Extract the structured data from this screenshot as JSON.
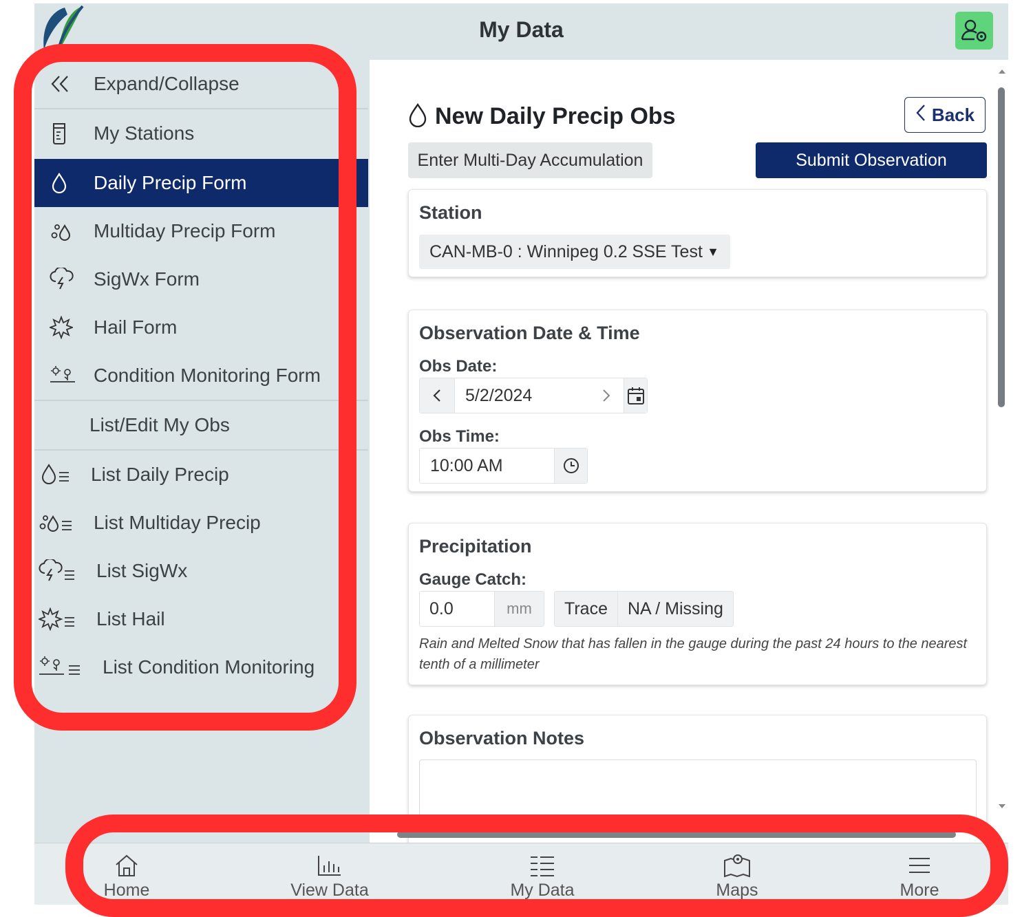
{
  "header": {
    "title": "My Data"
  },
  "sidebar": {
    "items": [
      {
        "label": "Expand/Collapse"
      },
      {
        "label": "My Stations"
      },
      {
        "label": "Daily Precip Form"
      },
      {
        "label": "Multiday Precip Form"
      },
      {
        "label": "SigWx Form"
      },
      {
        "label": "Hail Form"
      },
      {
        "label": "Condition Monitoring Form"
      },
      {
        "label": "List/Edit My Obs"
      },
      {
        "label": "List Daily Precip"
      },
      {
        "label": "List Multiday Precip"
      },
      {
        "label": "List SigWx"
      },
      {
        "label": "List Hail"
      },
      {
        "label": "List Condition Monitoring"
      }
    ],
    "active_item": "Daily Precip Form"
  },
  "form": {
    "title": "New Daily Precip Obs",
    "back_label": "Back",
    "multiday_label": "Enter Multi-Day Accumulation",
    "submit_label": "Submit Observation",
    "station": {
      "title": "Station",
      "selected": "CAN-MB-0 : Winnipeg 0.2 SSE Test"
    },
    "datetime": {
      "title": "Observation Date & Time",
      "date_label": "Obs Date:",
      "date_value": "5/2/2024",
      "time_label": "Obs Time:",
      "time_value": "10:00 AM"
    },
    "precip": {
      "title": "Precipitation",
      "gauge_label": "Gauge Catch:",
      "gauge_value": "0.0",
      "unit": "mm",
      "trace_label": "Trace",
      "missing_label": "NA / Missing",
      "help": "Rain and Melted Snow that has fallen in the gauge during the past 24 hours to the nearest tenth of a millimeter"
    },
    "notes": {
      "title": "Observation Notes"
    }
  },
  "bottom_nav": [
    {
      "label": "Home"
    },
    {
      "label": "View Data"
    },
    {
      "label": "My Data"
    },
    {
      "label": "Maps"
    },
    {
      "label": "More"
    }
  ],
  "colors": {
    "primary": "#0f2a6b",
    "background": "#dbe4e6",
    "profile": "#5fd47a",
    "annotation": "#ff2e2e"
  }
}
